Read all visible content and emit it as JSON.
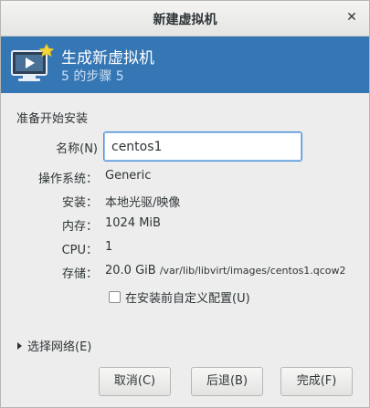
{
  "window": {
    "title": "新建虚拟机",
    "close_icon": "close-icon"
  },
  "banner": {
    "title": "生成新虚拟机",
    "step": "5 的步骤 5",
    "icon": "vm-monitor-icon"
  },
  "section": {
    "title": "准备开始安装"
  },
  "fields": {
    "name_label": "名称(N)",
    "name_value": "centos1",
    "os_label": "操作系统：",
    "os_value": "Generic",
    "install_label": "安装：",
    "install_value": "本地光驱/映像",
    "memory_label": "内存：",
    "memory_value": "1024 MiB",
    "cpu_label": "CPU：",
    "cpu_value": "1",
    "storage_label": "存储：",
    "storage_value": "20.0 GiB",
    "storage_path": "/var/lib/libvirt/images/centos1.qcow2"
  },
  "customize": {
    "label": "在安装前自定义配置(U)",
    "checked": false
  },
  "network": {
    "label": "选择网络(E)"
  },
  "buttons": {
    "cancel": "取消(C)",
    "back": "后退(B)",
    "finish": "完成(F)"
  }
}
